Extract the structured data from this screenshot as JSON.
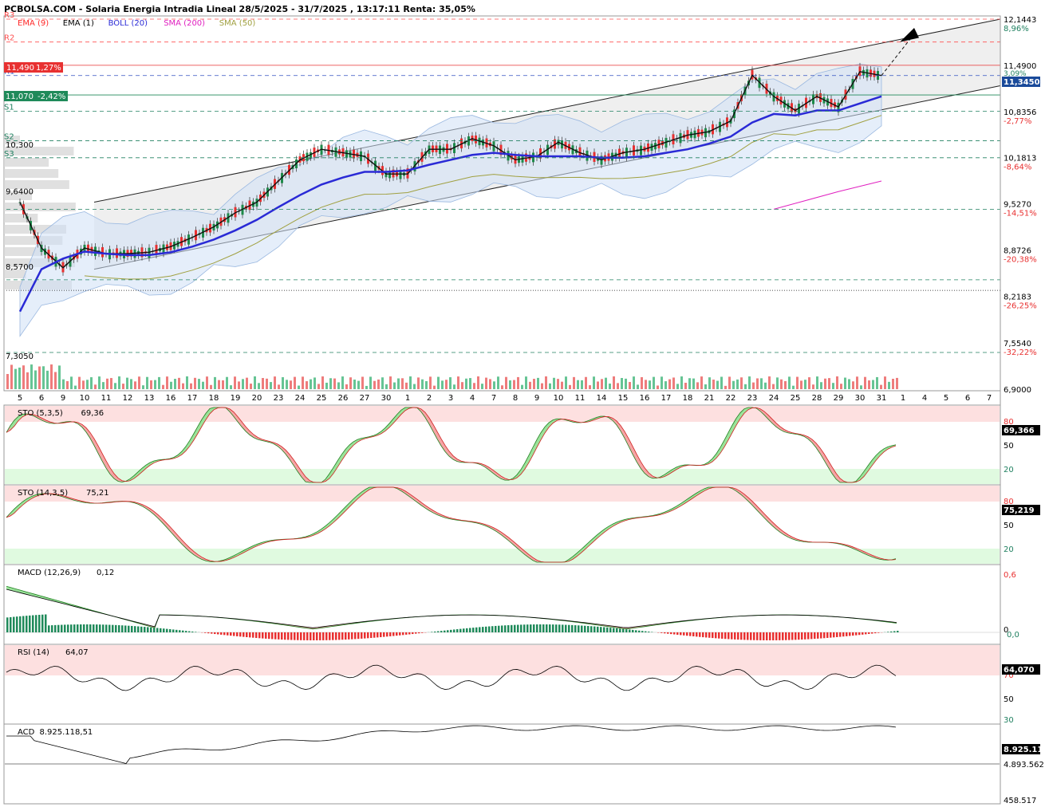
{
  "header": {
    "title": "PCBOLSA.COM - Solaria Energia Intradia Lineal 28/5/2025 - 31/7/2025 , 13:17:11 Renta: 35,05%"
  },
  "legend": [
    {
      "label": "EMA (9)",
      "color": "#ff2a2a"
    },
    {
      "label": "EMA (1)",
      "color": "#000000"
    },
    {
      "label": "BOLL (20)",
      "color": "#2a2ad6"
    },
    {
      "label": "SMA (200)",
      "color": "#e020c0"
    },
    {
      "label": "SMA (50)",
      "color": "#a0a040"
    }
  ],
  "levels": [
    {
      "label": "R3",
      "price": 12.1443,
      "color": "#ff5050"
    },
    {
      "label": "R2",
      "price": 11.82,
      "color": "#ff5050"
    },
    {
      "label": "R1",
      "price": 11.345,
      "color": "#3050c0"
    },
    {
      "label": "S1",
      "price": 10.84,
      "color": "#208060"
    },
    {
      "label": "S2",
      "price": 10.42,
      "color": "#208060"
    },
    {
      "label": "S3",
      "price": 10.18,
      "color": "#208060"
    }
  ],
  "badges": {
    "red_price": "11,490",
    "red_change": "1,27%",
    "green_price": "11,070",
    "green_change": "-2,42%",
    "last_price": "11,3450",
    "last_pct": "3,09%"
  },
  "left_labels": [
    "10,300",
    "9,6400",
    "8,5700",
    "7,3050"
  ],
  "price_axis": [
    {
      "value": "12,1443",
      "pct": "8,96%"
    },
    {
      "value": "11,4900",
      "pct": ""
    },
    {
      "value": "10,8356",
      "pct": "-2,77%"
    },
    {
      "value": "10,1813",
      "pct": "-8,64%"
    },
    {
      "value": "9,5270",
      "pct": "-14,51%"
    },
    {
      "value": "8,8726",
      "pct": "-20,38%"
    },
    {
      "value": "8,2183",
      "pct": "-26,25%"
    },
    {
      "value": "7,5540",
      "pct": "-32,22%"
    },
    {
      "value": "6,9000",
      "pct": ""
    }
  ],
  "x_axis": [
    "5",
    "6",
    "9",
    "10",
    "11",
    "12",
    "13",
    "16",
    "17",
    "18",
    "19",
    "20",
    "23",
    "24",
    "25",
    "26",
    "27",
    "30",
    "1",
    "2",
    "3",
    "4",
    "7",
    "8",
    "9",
    "10",
    "11",
    "14",
    "15",
    "16",
    "17",
    "18",
    "21",
    "22",
    "23",
    "24",
    "25",
    "28",
    "29",
    "30",
    "31",
    "1",
    "4",
    "5",
    "6",
    "7"
  ],
  "panels": {
    "sto1": {
      "label": "STO (5,3,5)",
      "value": "69,36",
      "badge": "69,366",
      "ticks": [
        "80",
        "50",
        "20"
      ]
    },
    "sto2": {
      "label": "STO (14,3,5)",
      "value": "75,21",
      "badge": "75,219",
      "ticks": [
        "80",
        "50",
        "20"
      ]
    },
    "macd": {
      "label": "MACD (12,26,9)",
      "value": "0,12",
      "ticks": [
        "0,6",
        "0",
        "0,0"
      ]
    },
    "rsi": {
      "label": "RSI (14)",
      "value": "64,07",
      "badge": "64,070",
      "ticks": [
        "70",
        "50",
        "30"
      ]
    },
    "acd": {
      "label": "ACD",
      "value": "8.925.118,51",
      "badge": "8.925.11",
      "ticks": [
        "4.893.562",
        "458.517"
      ]
    }
  },
  "chart_data": {
    "type": "line",
    "title": "Solaria Energia Intradia Lineal 28/5/2025 - 31/7/2025",
    "ylim": [
      6.9,
      12.1443
    ],
    "x_dates": [
      "5/6",
      "6/6",
      "9/6",
      "10/6",
      "11/6",
      "12/6",
      "13/6",
      "16/6",
      "17/6",
      "18/6",
      "19/6",
      "20/6",
      "23/6",
      "24/6",
      "25/6",
      "26/6",
      "27/6",
      "30/6",
      "1/7",
      "2/7",
      "3/7",
      "4/7",
      "7/7",
      "8/7",
      "9/7",
      "10/7",
      "11/7",
      "14/7",
      "15/7",
      "16/7",
      "17/7",
      "18/7",
      "21/7",
      "22/7",
      "23/7",
      "24/7",
      "25/7",
      "28/7",
      "29/7",
      "30/7",
      "31/7"
    ],
    "price_close": [
      9.55,
      8.9,
      8.62,
      8.9,
      8.82,
      8.82,
      8.84,
      8.92,
      9.05,
      9.2,
      9.4,
      9.55,
      9.85,
      10.15,
      10.3,
      10.25,
      10.2,
      9.95,
      9.95,
      10.3,
      10.3,
      10.45,
      10.35,
      10.15,
      10.2,
      10.4,
      10.25,
      10.15,
      10.25,
      10.3,
      10.4,
      10.5,
      10.55,
      10.7,
      11.35,
      11.05,
      10.85,
      11.05,
      10.9,
      11.4,
      11.345
    ],
    "ema_20": [
      8.0,
      8.6,
      8.75,
      8.85,
      8.82,
      8.8,
      8.8,
      8.84,
      8.92,
      9.02,
      9.15,
      9.3,
      9.48,
      9.65,
      9.8,
      9.9,
      9.98,
      9.98,
      10.0,
      10.08,
      10.15,
      10.22,
      10.25,
      10.22,
      10.2,
      10.2,
      10.2,
      10.18,
      10.18,
      10.2,
      10.25,
      10.3,
      10.38,
      10.48,
      10.68,
      10.8,
      10.78,
      10.85,
      10.85,
      10.95,
      11.05
    ],
    "volume_last": 0,
    "indicators": {
      "sto_5_3_5": 69.36,
      "sto_14_3_5": 75.21,
      "macd_12_26_9": 0.12,
      "rsi_14": 64.07,
      "acd": 8925118.51
    }
  }
}
